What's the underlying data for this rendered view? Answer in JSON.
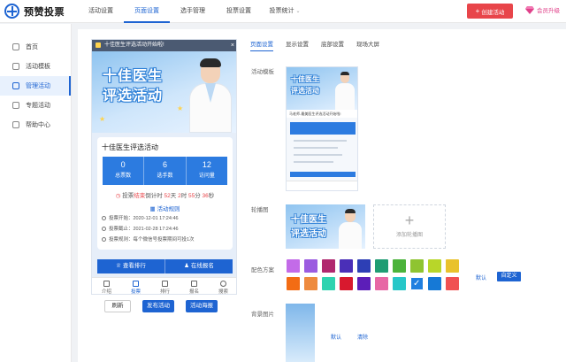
{
  "app": {
    "name": "预赞投票"
  },
  "topnav": {
    "items": [
      "活动设置",
      "页面设置",
      "选手管理",
      "投票设置",
      "投票统计"
    ],
    "active_index": 1,
    "create_label": "创建活动",
    "vip_label": "会员升级"
  },
  "sidebar": {
    "items": [
      "首页",
      "活动模板",
      "管理活动",
      "专题活动",
      "帮助中心"
    ],
    "active_index": 2
  },
  "preview": {
    "notice": "十佳医生评选活动开始啦!",
    "banner_line1": "十佳医生",
    "banner_line2": "评选活动",
    "activity_title": "十佳医生评选活动",
    "stats": [
      {
        "value": "0",
        "label": "总票数"
      },
      {
        "value": "6",
        "label": "选手数"
      },
      {
        "value": "12",
        "label": "访问量"
      }
    ],
    "countdown_prefix": "投票",
    "countdown_status": "结束",
    "countdown_mid": "倒计时",
    "countdown_days": "52",
    "countdown_hours": "2",
    "countdown_minutes": "55",
    "countdown_seconds": "36",
    "unit_day": "天",
    "unit_hour": "时",
    "unit_minute": "分",
    "unit_second": "秒",
    "rules_title": "活动规则",
    "rules": [
      "投票开始：2020-12-01 17:24:46",
      "投票截止：2021-02-28 17:24:46",
      "投票规则：每个微信号投票期间可投1次"
    ],
    "action_ranking": "查看排行",
    "action_signup": "在线报名",
    "tabs": [
      "介绍",
      "投票",
      "排行",
      "报名",
      "搜索"
    ],
    "active_tab": 1
  },
  "preview_buttons": {
    "refresh": "刷新",
    "publish": "发布活动",
    "poster": "活动海报"
  },
  "settings": {
    "tabs": [
      "页面设置",
      "显示设置",
      "底部设置",
      "现场大屏"
    ],
    "active_tab": 0,
    "template_label": "活动模板",
    "carousel_label": "轮播图",
    "add_carousel": "添加轮播图",
    "color_label": "配色方案",
    "color_default": "默认",
    "color_custom": "自定义",
    "bg_label": "背景图片",
    "bg_default": "默认",
    "bg_clear": "清除",
    "template_notice": "马老师-最美医生评选活动开始啦!"
  },
  "colors": {
    "accent": "#1e64d2",
    "swatches": [
      "#c36be8",
      "#9b5ce0",
      "#b0286e",
      "#4a2fb8",
      "#2d3fb5",
      "#1f9c73",
      "#4bb33b",
      "#8fc431",
      "#b8d629",
      "#e9c22c",
      "#f36c14",
      "#ee8a3e",
      "#2fd3b0",
      "#d8192e",
      "#5c1eb8",
      "#e767a5",
      "#27c7c8",
      "#1f7fe0",
      "#1679d6",
      "#f05152"
    ],
    "selected_swatch": 17
  }
}
